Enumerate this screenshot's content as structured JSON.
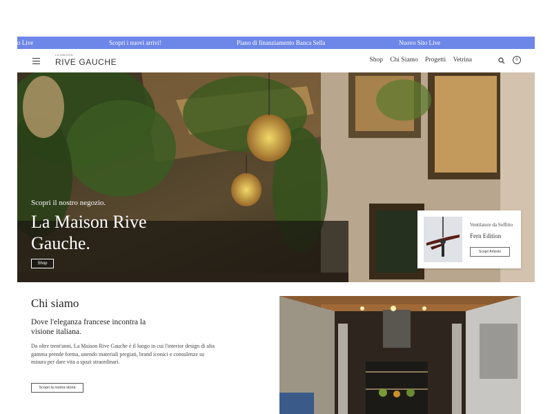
{
  "announcement": {
    "items": [
      "o Live",
      "Scopri i nuovi arrivi!",
      "Piano di finanziamento Banca Sella",
      "Nuovo Sito Live"
    ]
  },
  "header": {
    "logo_small": "LA MAISON",
    "logo_main": "RIVE GAUCHE",
    "nav": [
      "Shop",
      "Chi Siamo",
      "Progetti",
      "Vetrina"
    ],
    "cart_count": "0",
    "icons": [
      "menu-icon",
      "search-icon",
      "cart-icon"
    ]
  },
  "hero": {
    "subtitle": "Scopri il nostro negozio.",
    "title": "La Maison Rive Gauche.",
    "button": "Shop"
  },
  "product_card": {
    "name": "Ventilatore da Soffitto",
    "edition": "Fern Edition",
    "button": "Scopri Articolo"
  },
  "about": {
    "title": "Chi siamo",
    "lead": "Dove l'eleganza francese incontra la visione italiana.",
    "body": "Da oltre trent'anni, La Maison Rive Gauche è il luogo in cui l'interior design di alta gamma prende forma, unendo materiali pregiati, brand iconici e consulenze su misura per dare vita a spazi straordinari.",
    "button": "Scopri la nostra storia"
  },
  "colors": {
    "announce_bg": "#6d87e8",
    "text": "#222222"
  }
}
